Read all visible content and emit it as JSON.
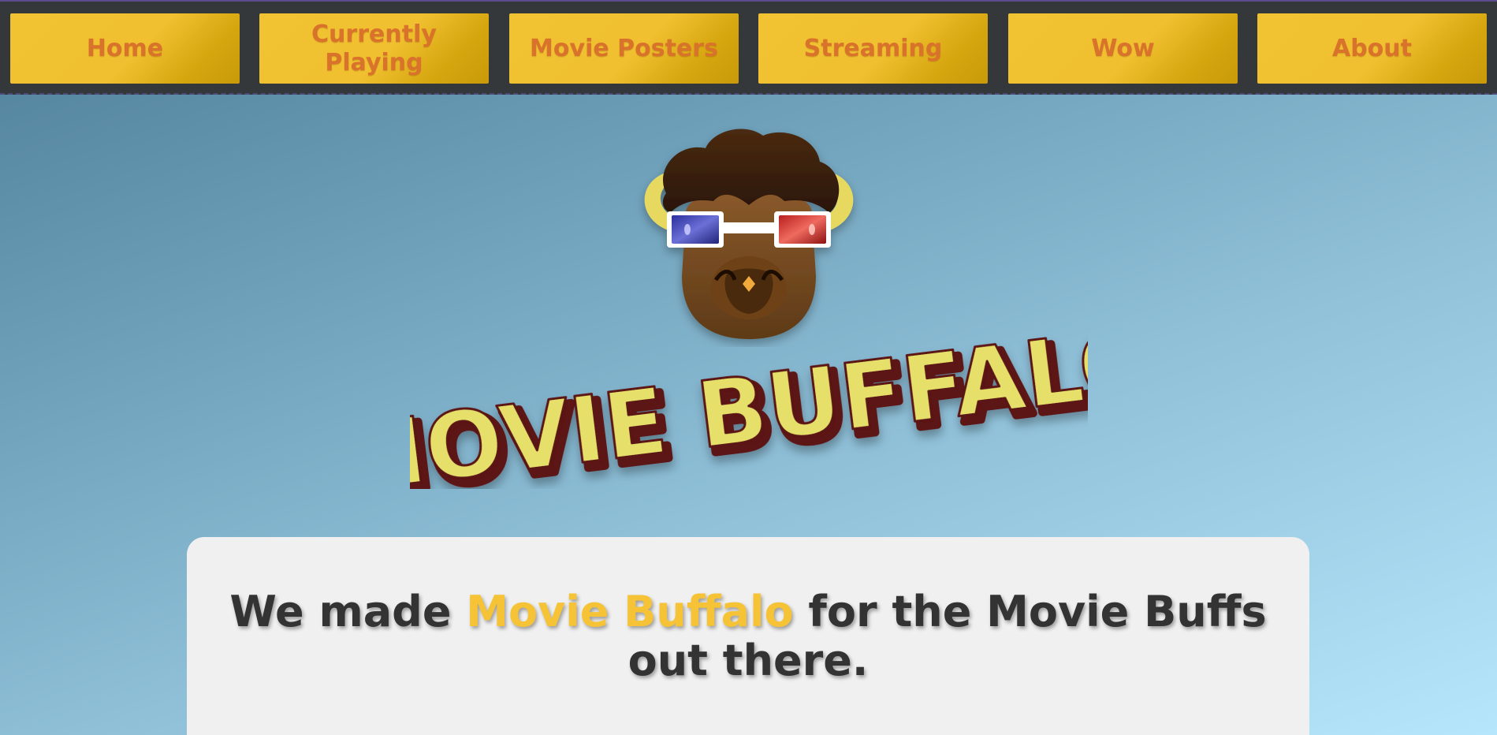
{
  "nav": {
    "items": [
      {
        "label": "Home"
      },
      {
        "label": "Currently Playing"
      },
      {
        "label": "Movie Posters"
      },
      {
        "label": "Streaming"
      },
      {
        "label": "Wow"
      },
      {
        "label": "About"
      }
    ]
  },
  "hero": {
    "logo_icon": "buffalo-with-3d-glasses-icon",
    "wordmark": "MOVIE BUFFALO"
  },
  "tagline": {
    "prefix": "We made ",
    "brand": "Movie Buffalo",
    "suffix": " for the Movie Buffs out there."
  },
  "colors": {
    "nav_background": "#34383b",
    "nav_button": "#f1c232",
    "nav_text": "#d9722a",
    "brand_accent": "#f5c335",
    "card_background": "#f0f0f0"
  }
}
